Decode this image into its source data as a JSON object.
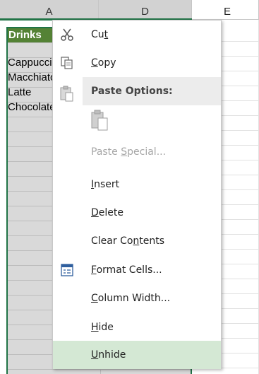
{
  "columns": {
    "a": "A",
    "b": "D",
    "e": "E"
  },
  "cells": {
    "header": "Drinks",
    "rows": [
      "Cappuccino",
      "Macchiato",
      "Latte",
      "Chocolate"
    ]
  },
  "menu": {
    "cut": {
      "pre": "Cu",
      "ul": "t",
      "post": ""
    },
    "copy": {
      "pre": "",
      "ul": "C",
      "post": "opy"
    },
    "paste_options": "Paste Options:",
    "paste_special": {
      "pre": "Paste ",
      "ul": "S",
      "post": "pecial..."
    },
    "insert": {
      "pre": "",
      "ul": "I",
      "post": "nsert"
    },
    "delete": {
      "pre": "",
      "ul": "D",
      "post": "elete"
    },
    "clear_contents": {
      "pre": "Clear Co",
      "ul": "n",
      "post": "tents"
    },
    "format_cells": {
      "pre": "",
      "ul": "F",
      "post": "ormat Cells..."
    },
    "column_width": {
      "pre": "",
      "ul": "C",
      "post": "olumn Width..."
    },
    "hide": {
      "pre": "",
      "ul": "H",
      "post": "ide"
    },
    "unhide": {
      "pre": "",
      "ul": "U",
      "post": "nhide"
    }
  },
  "colors": {
    "accent": "#217346",
    "header_fill": "#548235",
    "hover": "#d4e8d4"
  },
  "icons": [
    "scissors-icon",
    "copy-icon",
    "clipboard-icon",
    "format-cells-icon"
  ]
}
